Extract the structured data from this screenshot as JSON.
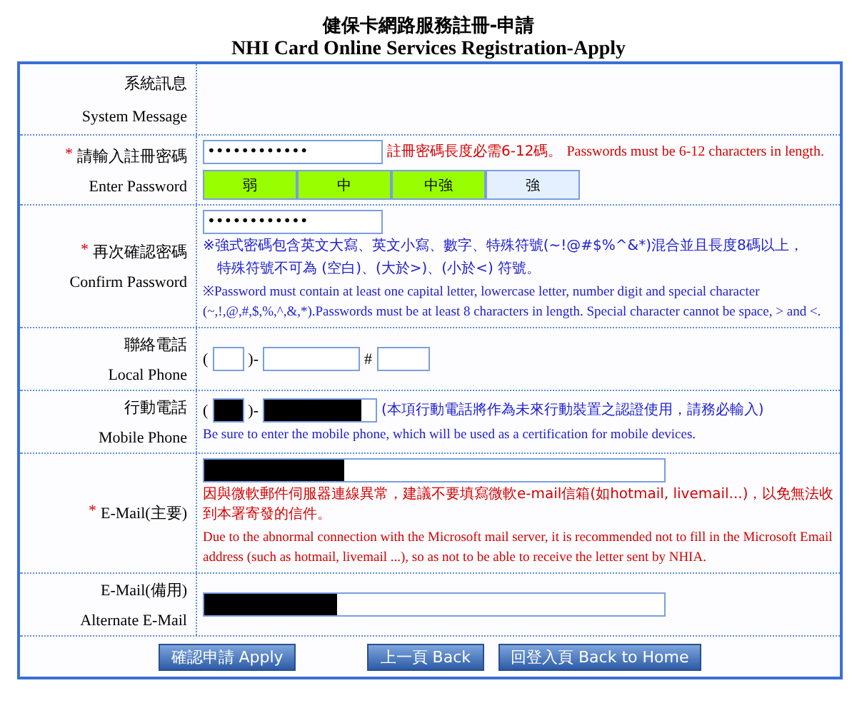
{
  "title": "健保卡網路服務註冊-申請",
  "subtitle": "NHI Card Online Services Registration-Apply",
  "system_message": {
    "label_zh": "系統訊息",
    "label_en": "System Message"
  },
  "password": {
    "required_mark": "*",
    "label_zh": "請輸入註冊密碼",
    "label_en": "Enter Password",
    "value": "••••••••••••",
    "hint_zh": "註冊密碼長度必需6-12碼。",
    "hint_en": "Passwords must be 6-12 characters in length.",
    "strength": [
      {
        "label": "弱",
        "on": true
      },
      {
        "label": "中",
        "on": true
      },
      {
        "label": "中強",
        "on": true
      },
      {
        "label": "強",
        "on": false
      }
    ]
  },
  "confirm_password": {
    "required_mark": "*",
    "label_zh": "再次確認密碼",
    "label_en": "Confirm Password",
    "value": "••••••••••••",
    "rules_zh": [
      "※強式密碼包含英文大寫、英文小寫、數字、特殊符號(~!@#$%^&*)混合並且長度8碼以上，",
      "特殊符號不可為 (空白)、(大於>)、(小於<) 符號。"
    ],
    "rule_en": "※Password must contain at least one capital letter, lowercase letter, number digit and special character (~,!,@,#,$,%,^,&,*).Passwords must be at least 8 characters in length. Special character cannot be space, > and <."
  },
  "local_phone": {
    "label_zh": "聯絡電話",
    "label_en": "Local Phone",
    "open": "(",
    "sep": ")-",
    "ext": "#"
  },
  "mobile_phone": {
    "label_zh": "行動電話",
    "label_en": "Mobile Phone",
    "open": "(",
    "sep": ")-",
    "redacted": true,
    "note_zh": "(本項行動電話將作為未來行動裝置之認證使用，請務必輸入)",
    "note_en": "Be sure to enter the mobile phone, which will be used as a certification for mobile devices."
  },
  "email": {
    "required_mark": "*",
    "label": "E-Mail(主要)",
    "redacted": true,
    "warning_zh": "因與微軟郵件伺服器連線異常，建議不要填寫微軟e-mail信箱(如hotmail, livemail...)，以免無法收到本署寄發的信件。",
    "warning_en": "Due to the abnormal connection with the Microsoft mail server, it is recommended not to fill in the Microsoft Email address (such as hotmail, livemail ...), so as not to be able to receive the letter sent by NHIA."
  },
  "alternate_email": {
    "label_zh": "E-Mail(備用)",
    "label_en": "Alternate E-Mail",
    "redacted": true
  },
  "buttons": [
    "確認申請 Apply",
    "上一頁 Back",
    "回登入頁 Back to Home"
  ]
}
